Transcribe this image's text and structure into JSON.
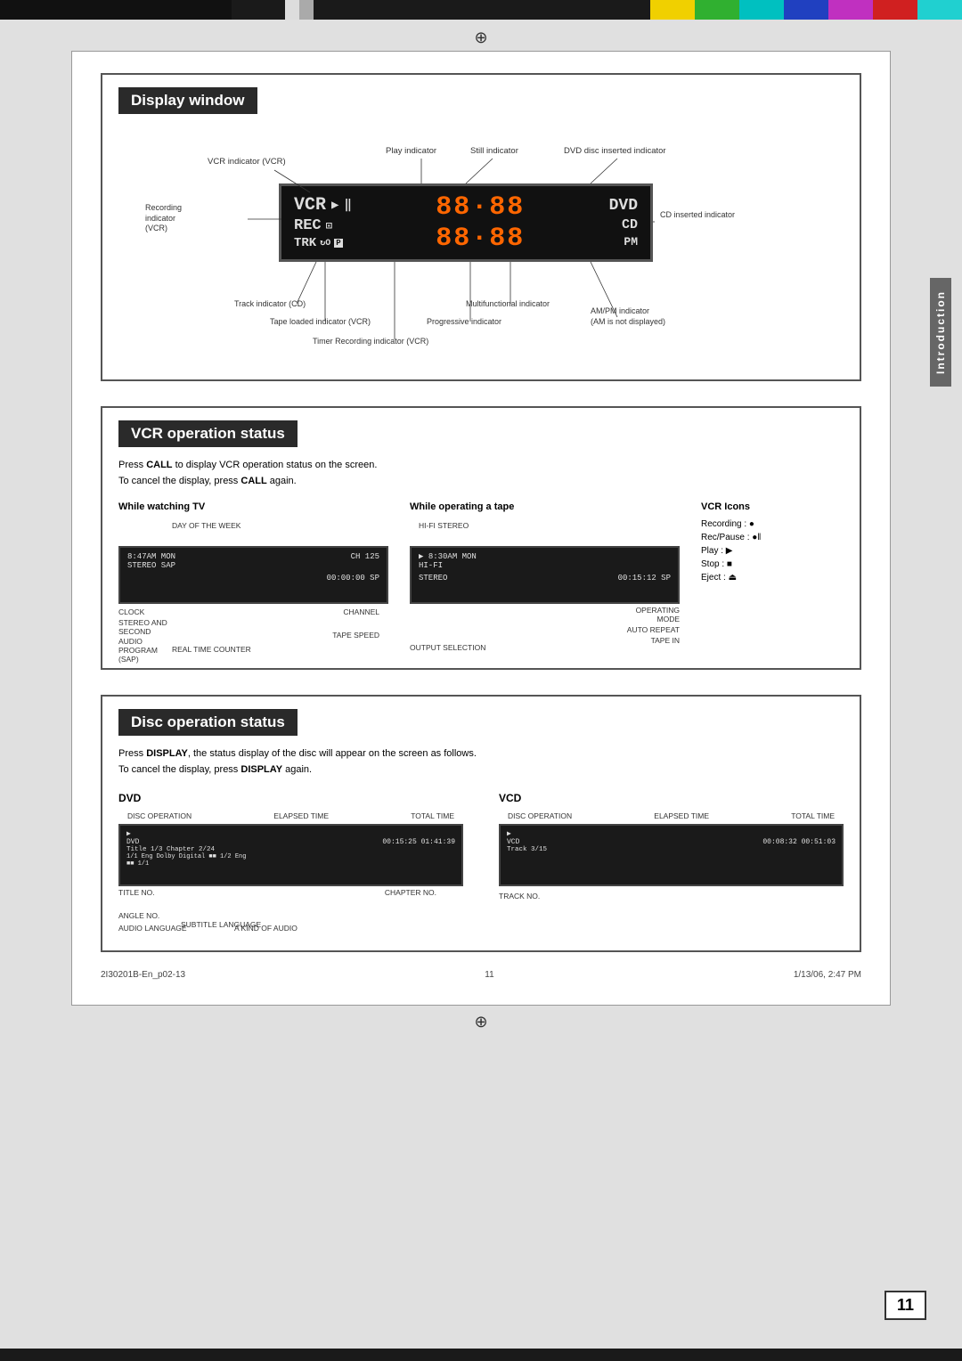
{
  "colorbar": {
    "topBlack": "black",
    "colors": [
      "#f0d000",
      "#00b000",
      "#00c0c0",
      "#0040c0",
      "#c000c0",
      "#d00000",
      "#00d0d0"
    ]
  },
  "section1": {
    "title": "Display window",
    "annotations": {
      "play_indicator": "Play indicator",
      "vcr_indicator": "VCR indicator (VCR)",
      "still_indicator": "Still indicator",
      "dvd_disc_indicator": "DVD disc inserted indicator",
      "recording_indicator": "Recording\nindicator\n(VCR)",
      "cd_inserted": "CD inserted\nindicator",
      "track_indicator": "Track indicator (CD)",
      "multifunctional": "Multifunctional indicator",
      "tape_loaded": "Tape loaded indicator (VCR)",
      "progressive": "Progressive indicator",
      "am_pm": "AM/PM indicator\n(AM is not displayed)",
      "timer_recording": "Timer Recording indicator (VCR)"
    },
    "display": {
      "vcr": "VCR",
      "play": "▶",
      "pause": "‖",
      "rec": "REC",
      "rec_icon": "⊡",
      "trk": "TRK",
      "oto": "↻O",
      "prog": "P",
      "time": "88·88",
      "time2": "88·88",
      "dvd": "DVD",
      "cd": "CD",
      "pm": "PM"
    }
  },
  "section2": {
    "title": "VCR operation status",
    "desc1": "Press CALL to display VCR operation status on the screen.",
    "desc2": "To cancel the display, press CALL again.",
    "watching_tv": {
      "label": "While watching TV",
      "annotations": {
        "day_of_week": "DAY OF THE WEEK",
        "clock": "CLOCK",
        "stereo_and": "STEREO AND",
        "second": "SECOND",
        "audio": "AUDIO",
        "program": "PROGRAM",
        "sap": "(SAP)",
        "channel": "CHANNEL",
        "tape_speed": "TAPE SPEED",
        "real_time": "REAL TIME COUNTER"
      },
      "screen_lines": [
        "8:47AM MON    CH 125",
        "STEREO SAP",
        "",
        "00:00:00 SP"
      ]
    },
    "operating_tape": {
      "label": "While operating a tape",
      "annotations": {
        "hifi_stereo": "HI-FI STEREO",
        "operating_mode": "OPERATING\nMODE",
        "auto_repeat": "AUTO REPEAT",
        "tape_in": "TAPE IN",
        "output_selection": "OUTPUT SELECTION"
      },
      "screen_lines": [
        "▶  8:30AM MON",
        "   HI-FI",
        "",
        "STEREO   00:15:12 SP"
      ]
    },
    "vcr_icons": {
      "label": "VCR Icons",
      "items": [
        "Recording : ●",
        "Rec/Pause : ●‖",
        "Play : ▶",
        "Stop : ■",
        "Eject : ⏏"
      ]
    }
  },
  "section3": {
    "title": "Disc operation status",
    "desc1": "Press DISPLAY, the status display of the disc will appear on the screen as follows.",
    "desc2": "To cancel the display, press DISPLAY again.",
    "dvd": {
      "label": "DVD",
      "annotations": {
        "disc_operation": "DISC OPERATION",
        "elapsed_time": "ELAPSED\nTIME",
        "total_time": "TOTAL\nTIME",
        "title_no": "TITLE NO.",
        "chapter_no": "CHAPTER\nNO.",
        "angle_no": "ANGLE NO.",
        "subtitle": "SUBTITLE LANGUAGE",
        "audio_lang": "AUDIO LANGUAGE",
        "kind_of_audio": "A KIND OF AUDIO"
      },
      "screen_lines": [
        "DVD         00:15:25  01:41:39",
        "Title 1/3   Chapter 2/24",
        "1/1 Eng Dolby Digital  ■■  1/2 Eng",
        "■■ 1/1"
      ]
    },
    "vcd": {
      "label": "VCD",
      "annotations": {
        "disc_operation": "DISC OPERATION",
        "elapsed_time": "ELAPSED\nTIME",
        "total_time": "TOTAL\nTIME",
        "track_no": "TRACK NO."
      },
      "screen_lines": [
        "VCD         00:08:32  00:51:03",
        "Track 3/15"
      ]
    }
  },
  "footer": {
    "left": "2I30201B-En_p02-13",
    "center": "11",
    "right": "1/13/06, 2:47 PM",
    "page_number": "11"
  },
  "sidebar": {
    "label": "Introduction"
  }
}
